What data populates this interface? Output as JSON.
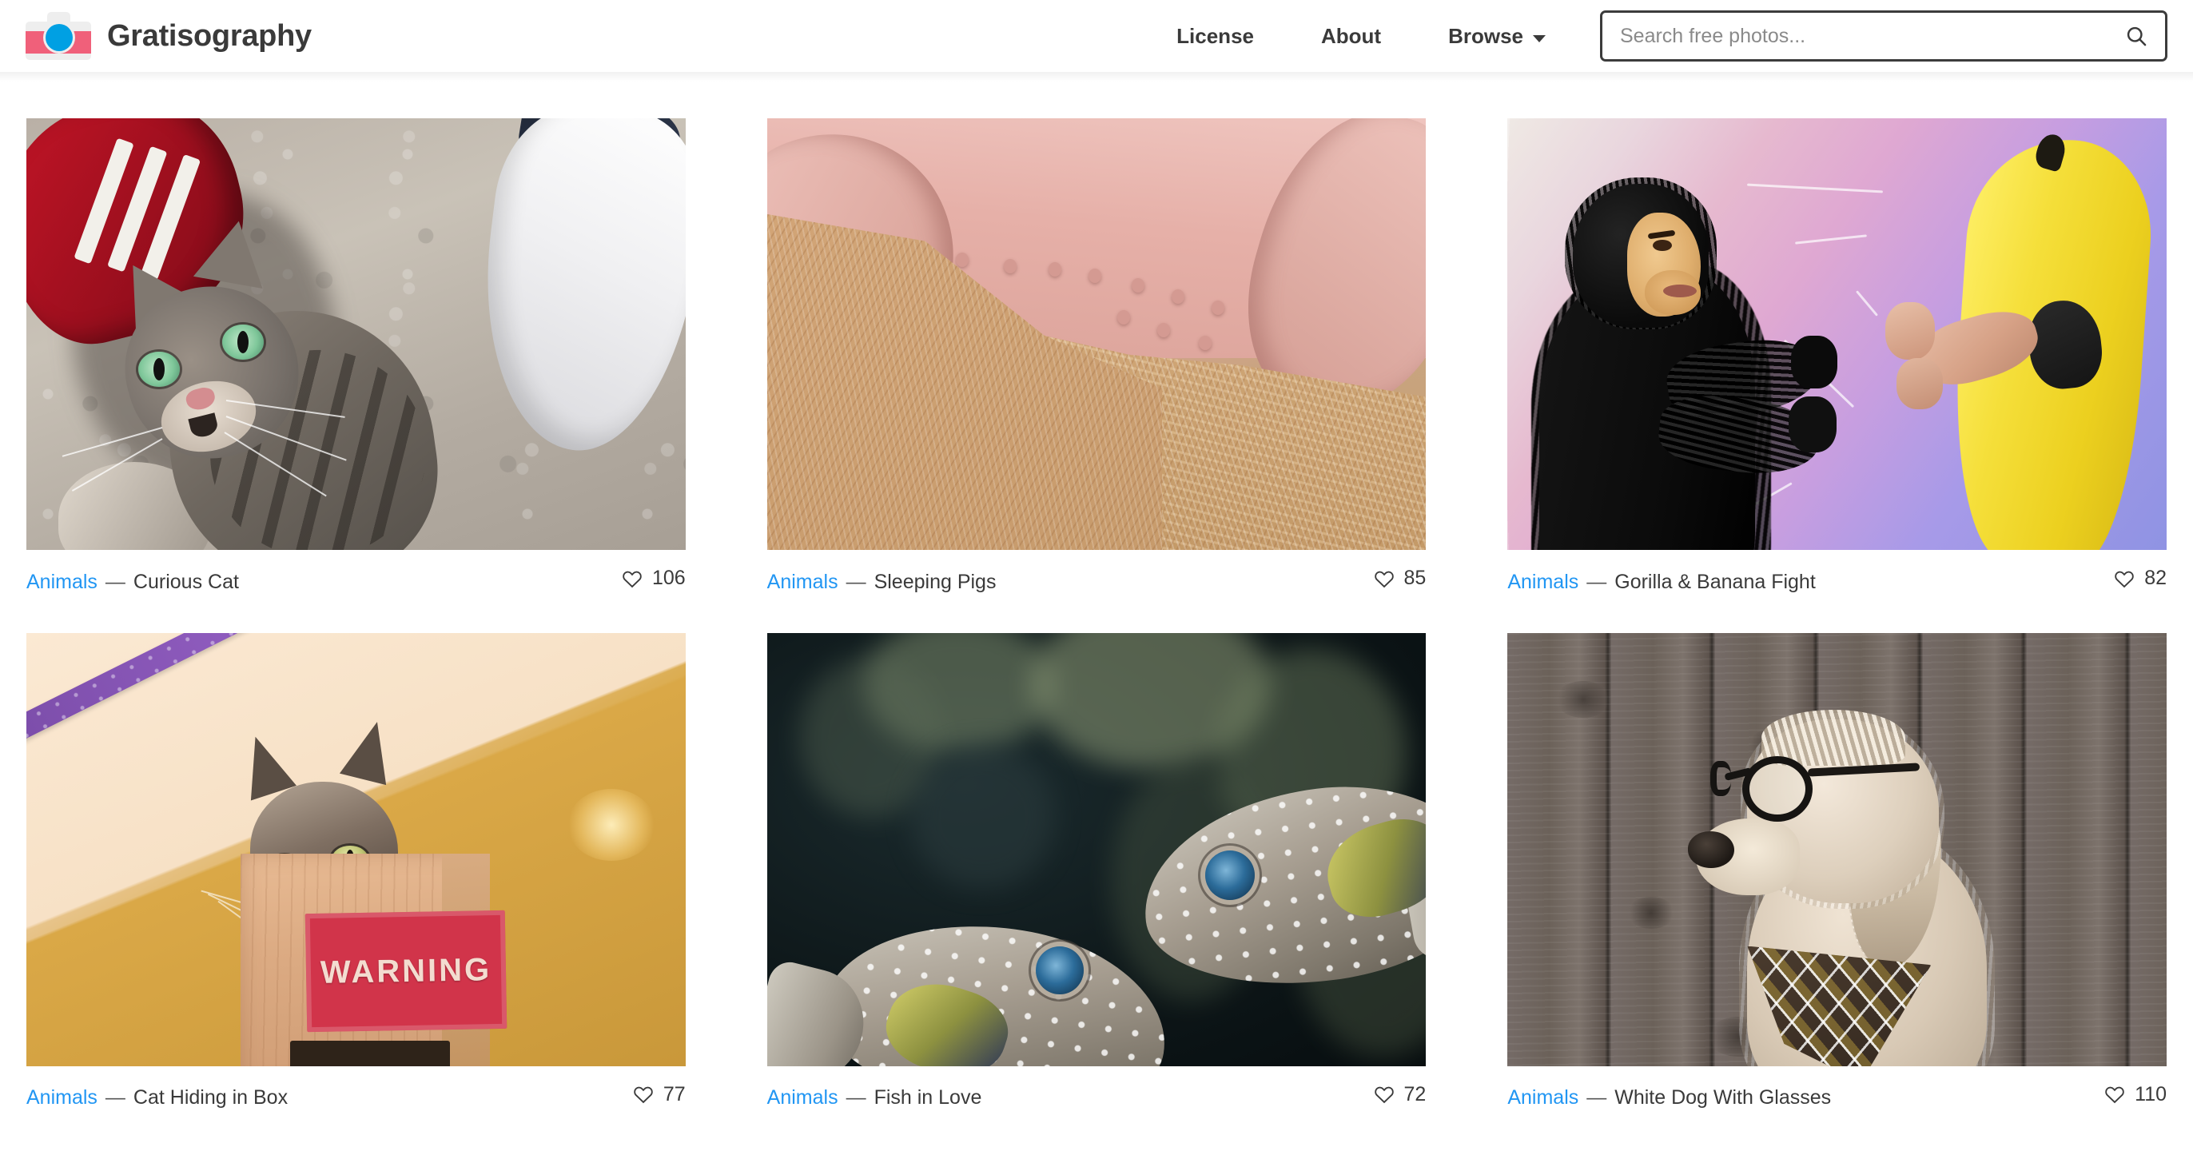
{
  "header": {
    "brand_name": "Gratisography",
    "logo_icon": "camera-icon",
    "nav": [
      {
        "label": "License",
        "has_caret": false
      },
      {
        "label": "About",
        "has_caret": false
      },
      {
        "label": "Browse",
        "has_caret": true
      }
    ],
    "search": {
      "placeholder": "Search free photos...",
      "value": "",
      "icon": "search-icon"
    }
  },
  "gallery": {
    "like_icon": "heart-outline-icon",
    "separator": "—",
    "items": [
      {
        "category": "Animals",
        "title": "Curious Cat",
        "likes": "106",
        "photo": "cat-on-pavement-between-sneakers"
      },
      {
        "category": "Animals",
        "title": "Sleeping Pigs",
        "likes": "85",
        "photo": "piglet-legs-on-sawdust"
      },
      {
        "category": "Animals",
        "title": "Gorilla & Banana Fight",
        "likes": "82",
        "photo": "gorilla-costume-versus-banana-costume"
      },
      {
        "category": "Animals",
        "title": "Cat Hiding in Box",
        "likes": "77",
        "photo": "cat-peeking-over-warning-crate"
      },
      {
        "category": "Animals",
        "title": "Fish in Love",
        "likes": "72",
        "photo": "two-pufferfish-facing-each-other"
      },
      {
        "category": "Animals",
        "title": "White Dog With Glasses",
        "likes": "110",
        "photo": "shaggy-dog-wearing-round-glasses"
      }
    ]
  },
  "photo_text": {
    "warning_sign": "WARNING"
  },
  "colors": {
    "link": "#2196f3",
    "text": "#3a3a3a",
    "logo_band": "#f0607a",
    "logo_lens": "#00a0e3",
    "background": "#ffffff"
  }
}
